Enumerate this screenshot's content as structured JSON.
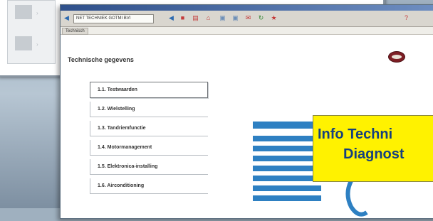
{
  "browser": {
    "address": "NET TECHNIEK GOTMI BVI",
    "tab_label": "Technisch"
  },
  "page": {
    "title": "Technische gegevens"
  },
  "menu": [
    {
      "number": "1.1.",
      "label": "Testwaarden",
      "active": true
    },
    {
      "number": "1.2.",
      "label": "Wielstelling",
      "active": false
    },
    {
      "number": "1.3.",
      "label": "Tandriemfunctie",
      "active": false
    },
    {
      "number": "1.4.",
      "label": "Motormanagement",
      "active": false
    },
    {
      "number": "1.5.",
      "label": "Elektronica-installing",
      "active": false
    },
    {
      "number": "1.6.",
      "label": "Airconditioning",
      "active": false
    }
  ],
  "banner": {
    "line1": "Info Techni",
    "line2": "Diagnost"
  },
  "colors": {
    "accent": "#2e80c2",
    "banner_bg": "#fff200",
    "banner_text": "#16407e"
  },
  "icons": [
    "back-icon",
    "forward-icon",
    "stop-icon",
    "home-icon",
    "print-icon"
  ]
}
